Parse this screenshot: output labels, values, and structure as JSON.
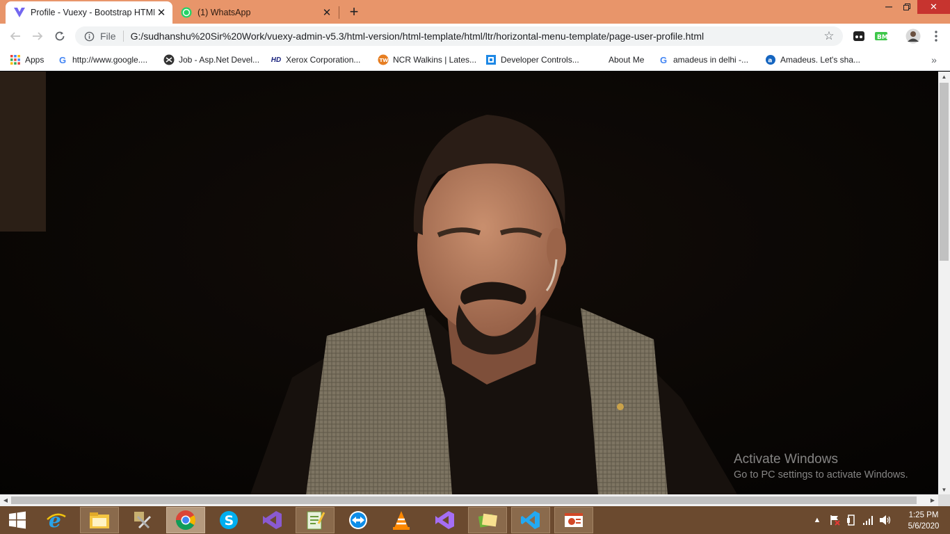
{
  "tabs": [
    {
      "title": "Profile - Vuexy - Bootstrap HTML",
      "active": true
    },
    {
      "title": "(1) WhatsApp",
      "active": false
    }
  ],
  "toolbar": {
    "info_label": "File",
    "url": "G:/sudhanshu%20Sir%20Work/vuexy-admin-v5.3/html-version/html-template/html/ltr/horizontal-menu-template/page-user-profile.html"
  },
  "bookmarks": [
    {
      "label": "Apps",
      "icon": "apps-grid-icon"
    },
    {
      "label": "http://www.google....",
      "icon": "google-icon"
    },
    {
      "label": "Job - Asp.Net Devel...",
      "icon": "job-icon"
    },
    {
      "label": "Xerox Corporation...",
      "icon": "hd-icon"
    },
    {
      "label": "NCR Walkins | Lates...",
      "icon": "tw-icon"
    },
    {
      "label": "Developer Controls...",
      "icon": "devcontrols-icon"
    },
    {
      "label": "About Me",
      "icon": ""
    },
    {
      "label": "amadeus in delhi -...",
      "icon": "google-icon"
    },
    {
      "label": "Amadeus. Let's sha...",
      "icon": "amadeus-icon"
    }
  ],
  "watermark": {
    "title": "Activate Windows",
    "subtitle": "Go to PC settings to activate Windows."
  },
  "taskbar": {
    "items": [
      "start",
      "internet-explorer",
      "file-explorer",
      "tools",
      "chrome",
      "skype",
      "visual-studio",
      "notepad-plus",
      "teamviewer",
      "vlc",
      "visual-studio-2019",
      "photos",
      "vscode",
      "powerpoint"
    ],
    "time": "1:25 PM",
    "date": "5/6/2020"
  },
  "colors": {
    "tabstrip": "#e8956a",
    "taskbar": "#6b4a2f",
    "close": "#c7342f"
  }
}
